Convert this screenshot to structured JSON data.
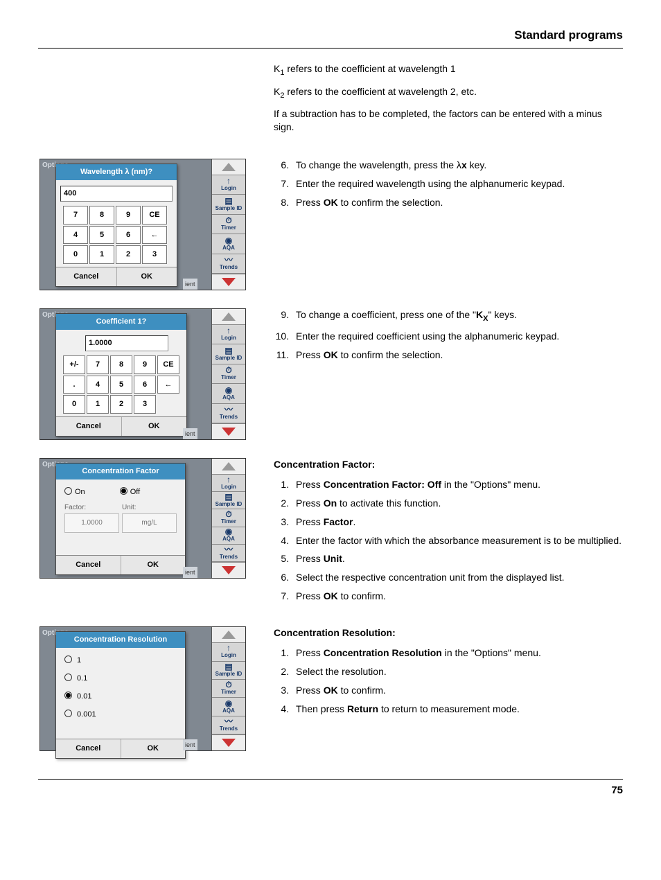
{
  "header": "Standard programs",
  "page_number": "75",
  "intro": {
    "k1": "K",
    "k1_sub": "1",
    "k1_rest": " refers to the coefficient at wavelength 1",
    "k2": "K",
    "k2_sub": "2",
    "k2_rest": " refers to the coefficient at wavelength 2, etc.",
    "note": "If a subtraction has to be completed, the factors can be entered with a minus sign."
  },
  "block1": {
    "dialog_title": "Wavelength λ (nm)?",
    "input": "400",
    "keys_row1": [
      "7",
      "8",
      "9",
      "CE"
    ],
    "keys_row2": [
      "4",
      "5",
      "6",
      "←"
    ],
    "keys_row3": [
      "0",
      "1",
      "2",
      "3"
    ],
    "cancel": "Cancel",
    "ok": "OK",
    "steps": [
      [
        "6.",
        "To change the wavelength, press the λ<b>x</b> key."
      ],
      [
        "7.",
        "Enter the required wavelength using the alphanumeric keypad."
      ],
      [
        "8.",
        "Press <b>OK</b> to confirm the selection."
      ]
    ]
  },
  "block2": {
    "dialog_title": "Coefficient 1?",
    "input": "1.0000",
    "keys_row1": [
      "+/-",
      "7",
      "8",
      "9",
      "CE"
    ],
    "keys_row2": [
      ".",
      "4",
      "5",
      "6",
      "←"
    ],
    "keys_row3": [
      "0",
      "1",
      "2",
      "3"
    ],
    "cancel": "Cancel",
    "ok": "OK",
    "steps": [
      [
        "9.",
        "To change a coefficient, press one of the \"<b>K<span class=\"sub-x\">X</span></b>\" keys."
      ],
      [
        "10.",
        "Enter the required coefficient using the alphanumeric keypad."
      ],
      [
        "11.",
        "Press <b>OK</b> to confirm the selection."
      ]
    ]
  },
  "block3": {
    "heading": "Concentration Factor:",
    "dialog_title": "Concentration Factor",
    "on": "On",
    "off": "Off",
    "factor_label": "Factor:",
    "unit_label": "Unit:",
    "factor_val": "1.0000",
    "unit_val": "mg/L",
    "cancel": "Cancel",
    "ok": "OK",
    "steps": [
      "Press <b>Concentration Factor: Off</b> in the \"Options\" menu.",
      "Press <b>On</b> to activate this function.",
      "Press <b>Factor</b>.",
      "Enter the factor with which the absorbance measurement is to be multiplied.",
      "Press <b>Unit</b>.",
      "Select the respective concentration unit from the displayed list.",
      "Press <b>OK</b> to confirm."
    ]
  },
  "block4": {
    "heading": "Concentration Resolution:",
    "dialog_title": "Concentration Resolution",
    "opts": [
      "1",
      "0.1",
      "0.01",
      "0.001"
    ],
    "selected": 2,
    "cancel": "Cancel",
    "ok": "OK",
    "steps": [
      "Press <b>Concentration Resolution</b> in the \"Options\" menu.",
      "Select the resolution.",
      "Press <b>OK</b> to confirm.",
      "Then press <b>Return</b> to return to measurement mode."
    ]
  },
  "sidebar": {
    "items": [
      {
        "icon": "↑",
        "label": "Login"
      },
      {
        "icon": "▤",
        "label": "Sample ID"
      },
      {
        "icon": "⏱",
        "label": "Timer"
      },
      {
        "icon": "◉",
        "label": "AQA"
      },
      {
        "icon": "〰",
        "label": "Trends"
      }
    ]
  },
  "misc": {
    "options": "Options",
    "ent": "ient"
  }
}
